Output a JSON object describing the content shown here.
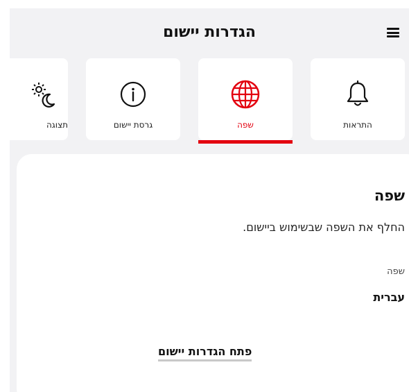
{
  "header": {
    "title": "הגדרות יישום",
    "menu_icon": "hamburger-menu-icon"
  },
  "tabs": [
    {
      "label": "התראות",
      "icon": "bell-icon",
      "active": false
    },
    {
      "label": "שפה",
      "icon": "globe-icon",
      "active": true
    },
    {
      "label": "גרסת יישום",
      "icon": "info-icon",
      "active": false
    },
    {
      "label": "תצוגה",
      "icon": "sun-moon-icon",
      "active": false
    }
  ],
  "section": {
    "title": "שפה",
    "description": "החלף את השפה שבשימוש ביישום.",
    "field_label": "שפה",
    "field_value": "עברית",
    "link_label": "פתח הגדרות יישום"
  },
  "colors": {
    "accent": "#e3000f",
    "background": "#f2f2f4",
    "card": "#ffffff"
  }
}
